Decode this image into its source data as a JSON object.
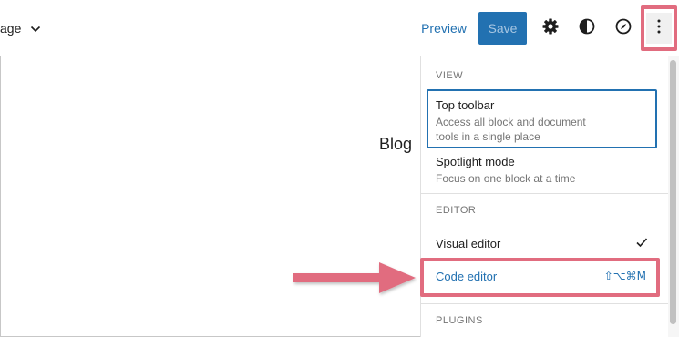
{
  "header": {
    "page_title_fragment": "age",
    "preview_label": "Preview",
    "save_label": "Save"
  },
  "canvas": {
    "text": "Blog"
  },
  "menu": {
    "view_heading": "VIEW",
    "items": {
      "top_toolbar": {
        "label": "Top toolbar",
        "desc_line1": "Access all block and document",
        "desc_line2": "tools in a single place"
      },
      "spotlight": {
        "label": "Spotlight mode",
        "desc": "Focus on one block at a time"
      }
    },
    "editor_heading": "EDITOR",
    "visual_editor": {
      "label": "Visual editor"
    },
    "code_editor": {
      "label": "Code editor",
      "shortcut": "⇧⌥⌘M"
    },
    "plugins_heading": "PLUGINS"
  },
  "colors": {
    "accent": "#2271b1",
    "highlight": "#e16c7f",
    "muted_text": "#757575"
  },
  "icons": [
    "chevron-down-icon",
    "gear-icon",
    "contrast-icon",
    "compass-icon",
    "more-vertical-icon",
    "check-icon",
    "arrow-right-icon"
  ]
}
